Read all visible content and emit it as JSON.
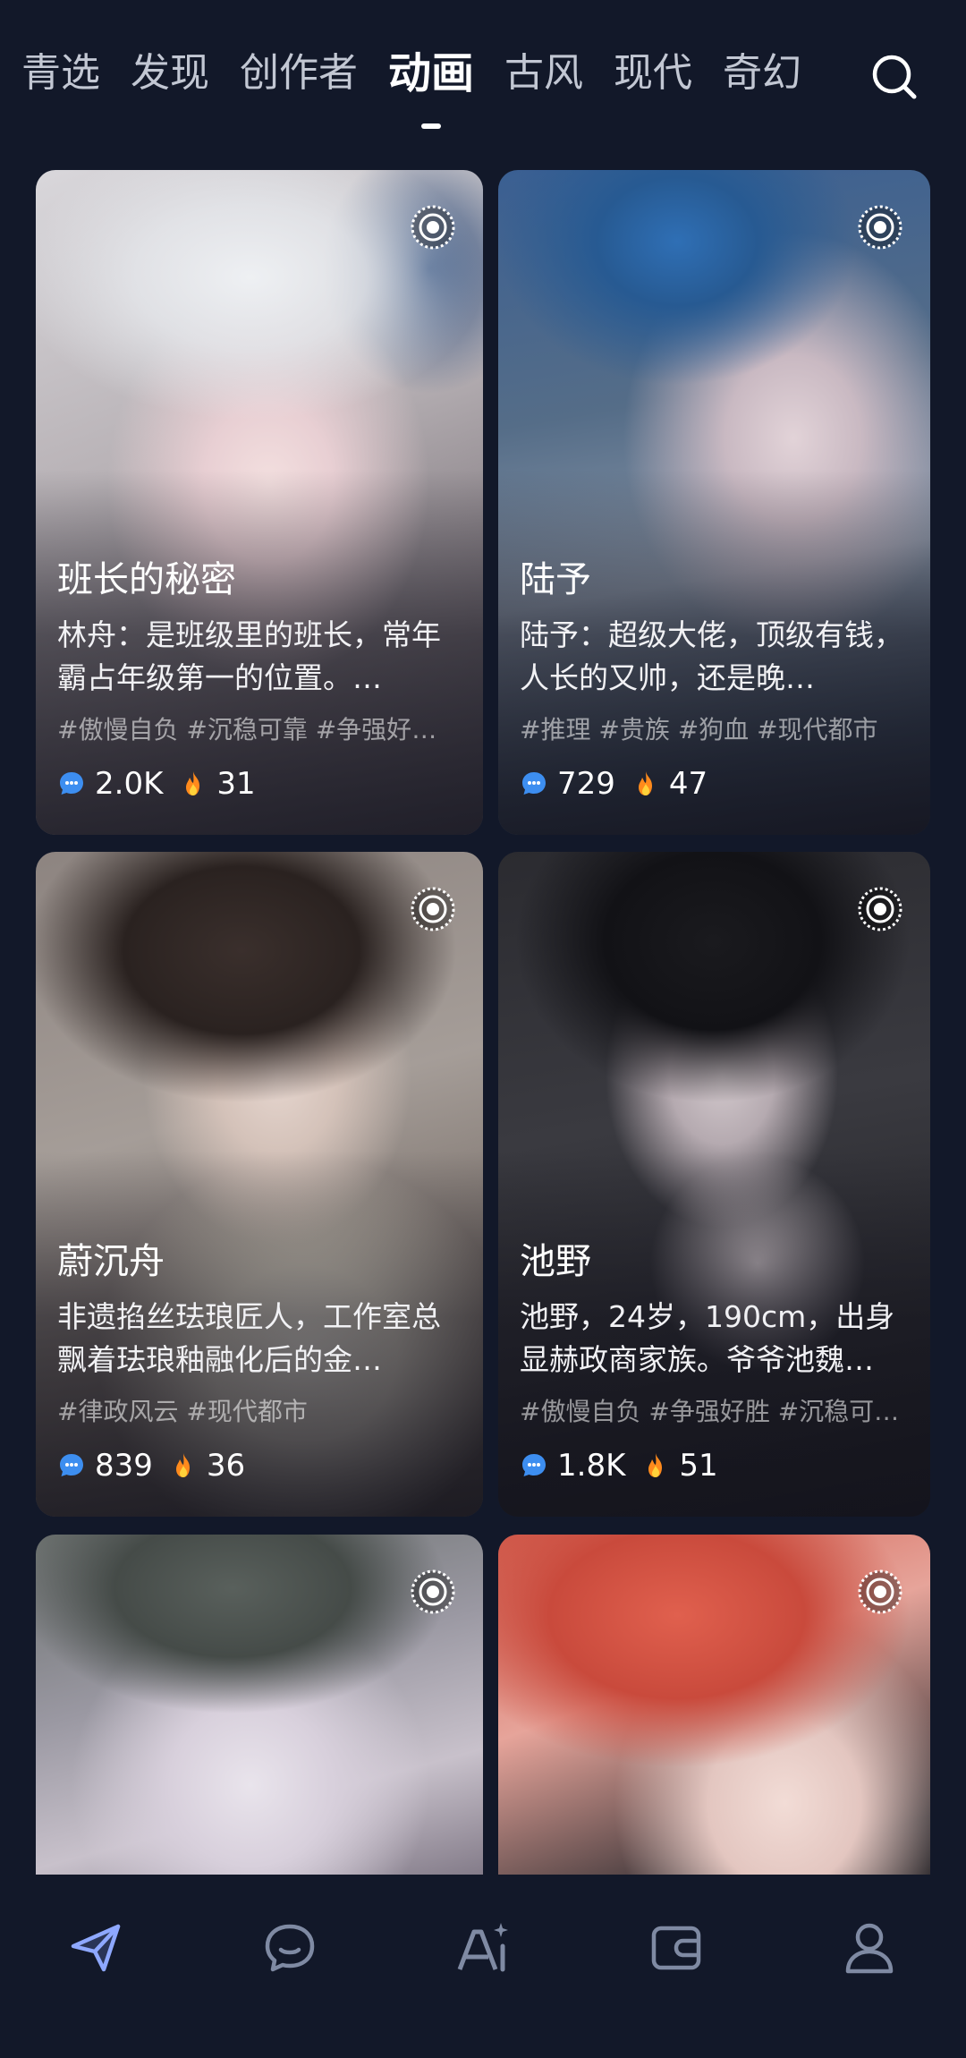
{
  "tabs": [
    {
      "label": "青选",
      "active": false
    },
    {
      "label": "发现",
      "active": false
    },
    {
      "label": "创作者",
      "active": false
    },
    {
      "label": "动画",
      "active": true
    },
    {
      "label": "古风",
      "active": false
    },
    {
      "label": "现代",
      "active": false
    },
    {
      "label": "奇幻",
      "active": false
    }
  ],
  "cards": [
    {
      "title": "班长的秘密",
      "desc": "林舟：是班级里的班长，常年霸占年级第一的位置。…",
      "tags": "#傲慢自负 #沉稳可靠 #争强好胜…",
      "chats": "2.0K",
      "hot": "31"
    },
    {
      "title": "陆予",
      "desc": "陆予：超级大佬，顶级有钱，人长的又帅，还是晚…",
      "tags": "#推理 #贵族 #狗血 #现代都市",
      "chats": "729",
      "hot": "47"
    },
    {
      "title": "蔚沉舟",
      "desc": "非遗掐丝珐琅匠人，工作室总飘着珐琅釉融化后的金…",
      "tags": "#律政风云 #现代都市",
      "chats": "839",
      "hot": "36"
    },
    {
      "title": "池野",
      "desc": "池野，24岁，190cm，出身显赫政商家族。爷爷池魏…",
      "tags": "#傲慢自负 #争强好胜 #沉稳可…",
      "chats": "1.8K",
      "hot": "51"
    }
  ],
  "icons": {
    "search": "search-icon",
    "live": "live-record-icon",
    "chat": "chat-bubble-icon",
    "hot": "fire-icon",
    "nav": [
      "paper-plane-icon",
      "chat-icon",
      "ai-create-icon",
      "wallet-icon",
      "profile-icon"
    ]
  },
  "colors": {
    "background": "#121829",
    "accent_blue": "#3d8ef0",
    "fire": "#ff8a1c",
    "nav_active": "#8ea8ff"
  }
}
